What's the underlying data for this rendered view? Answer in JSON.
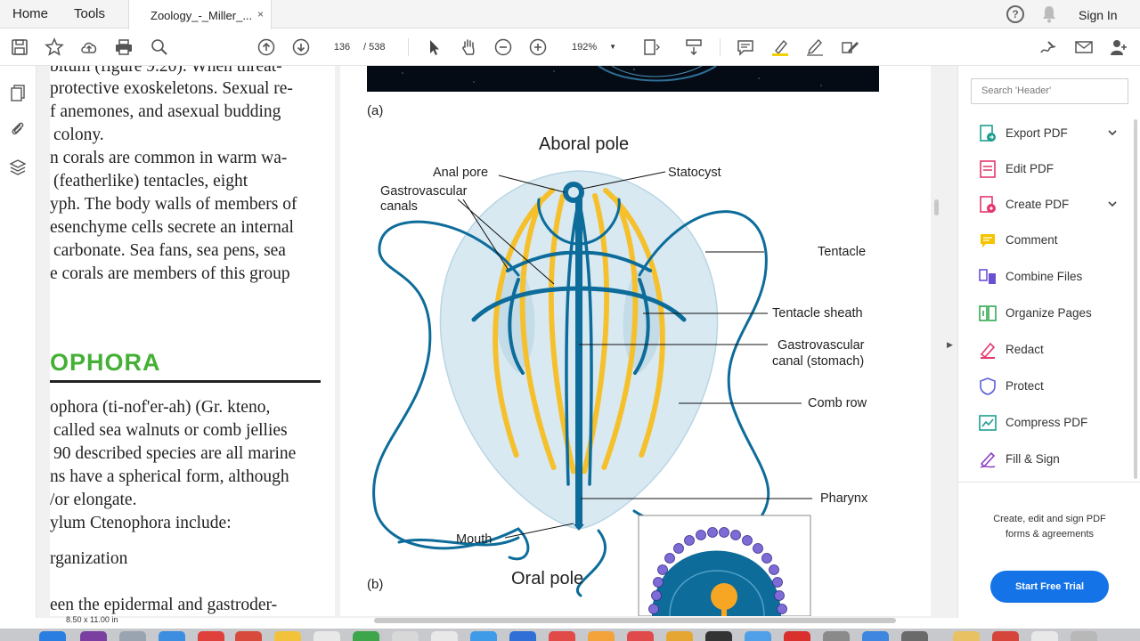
{
  "tabs": {
    "home": "Home",
    "tools": "Tools",
    "document": "Zoology_-_Miller_...",
    "close": "×",
    "help": "?",
    "sign_in": "Sign In"
  },
  "toolbar": {
    "page_current": "136",
    "page_sep_total": "/  538",
    "zoom": "192%"
  },
  "left_page": {
    "lines": [
      "bitum (figure 9.20). When threat-",
      "protective exoskeletons. Sexual re-",
      "f anemones, and asexual budding",
      "colony.",
      "n corals are common in warm wa-",
      "(featherlike) tentacles, eight",
      "yph. The body walls of members of",
      "esenchyme cells secrete an internal",
      "carbonate. Sea fans, sea pens, sea",
      "e corals are members of this group"
    ],
    "section_title": "OPHORA",
    "lines2": [
      "ophora (ti-nof'er-ah) (Gr. kteno,",
      "called sea walnuts or comb jellies",
      "90 described species are all marine",
      "ns have a spherical form, although",
      "/or elongate.",
      "ylum Ctenophora include:",
      "",
      "rganization",
      "",
      "een the epidermal and gastroder-"
    ],
    "page_size": "8.50 x 11.00 in"
  },
  "figure": {
    "label_a": "(a)",
    "label_b": "(b)",
    "labels": {
      "aboral_pole": "Aboral pole",
      "anal_pore": "Anal pore",
      "statocyst": "Statocyst",
      "gv_canals_1": "Gastrovascular",
      "gv_canals_2": "canals",
      "tentacle": "Tentacle",
      "tentacle_sheath": "Tentacle sheath",
      "gv_canal_1": "Gastrovascular",
      "gv_canal_2": "canal (stomach)",
      "comb_row": "Comb row",
      "pharynx": "Pharynx",
      "mouth": "Mouth",
      "oral_pole": "Oral pole"
    }
  },
  "right_panel": {
    "search_placeholder": "Search 'Header'",
    "tools": [
      {
        "label": "Export PDF",
        "color": "#1e9e8f",
        "expand": true
      },
      {
        "label": "Edit PDF",
        "color": "#e4376c",
        "expand": false
      },
      {
        "label": "Create PDF",
        "color": "#e4376c",
        "expand": true
      },
      {
        "label": "Comment",
        "color": "#f5c400",
        "expand": false
      },
      {
        "label": "Combine Files",
        "color": "#6b4fd3",
        "expand": false
      },
      {
        "label": "Organize Pages",
        "color": "#32a852",
        "expand": false
      },
      {
        "label": "Redact",
        "color": "#e4376c",
        "expand": false
      },
      {
        "label": "Protect",
        "color": "#5a5fd8",
        "expand": false
      },
      {
        "label": "Compress PDF",
        "color": "#1e9e8f",
        "expand": false
      },
      {
        "label": "Fill & Sign",
        "color": "#8a3fbf",
        "expand": false
      }
    ],
    "promo_line1": "Create, edit and sign PDF",
    "promo_line2": "forms & agreements",
    "trial_button": "Start Free Trial"
  },
  "colors": {
    "accent": "#1473e6",
    "section_green": "#44b035",
    "canal_blue": "#0d6c9a",
    "comb_yellow": "#f5c02b",
    "body_blue": "#d6e8f1"
  }
}
